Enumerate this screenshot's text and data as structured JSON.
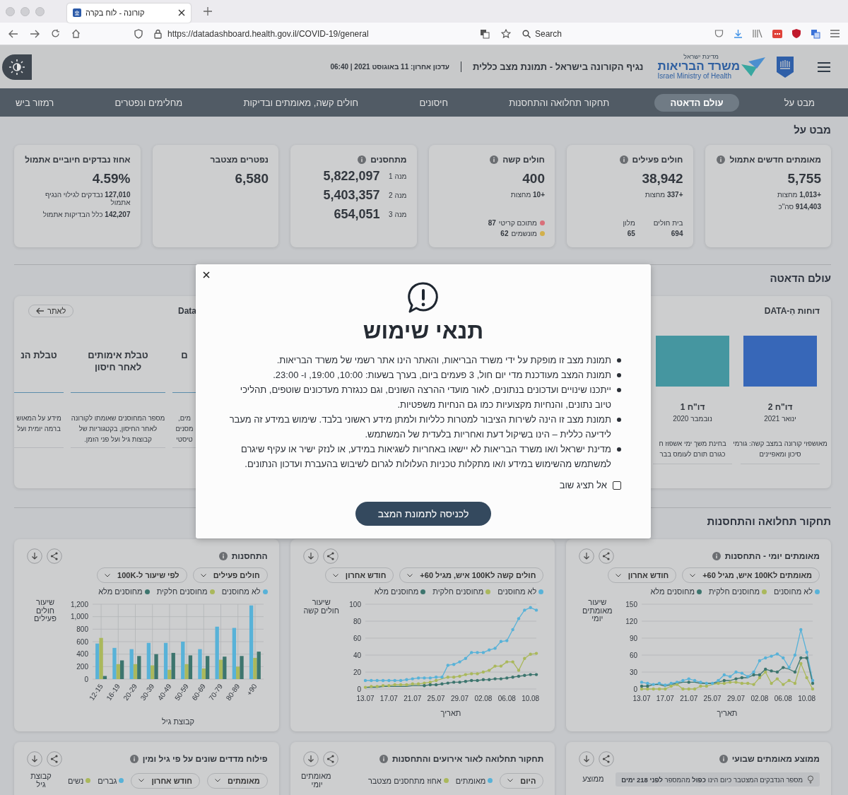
{
  "browser": {
    "tab_title": "קורונה - לוח בקרה",
    "url": "https://datadashboard.health.gov.il/COVID-19/general",
    "search": "Search"
  },
  "header": {
    "org_small": "מדינת ישראל",
    "org": "משרד הבריאות",
    "org_en": "Israel Ministry of Health",
    "title": "נגיף הקורונה בישראל - תמונת מצב כללית",
    "updated": "עדכון אחרון: 11 באוגוסט 2021 | 06:40"
  },
  "nav": [
    {
      "label": "מבט על",
      "selected": false
    },
    {
      "label": "עולם הדאטה",
      "selected": true
    },
    {
      "label": "תחקור תחלואה והתחסנות",
      "selected": false
    },
    {
      "label": "חיסונים",
      "selected": false
    },
    {
      "label": "חולים קשה, מאומתים ובדיקות",
      "selected": false
    },
    {
      "label": "מחלימים ונפטרים",
      "selected": false
    },
    {
      "label": "רמזור ביש",
      "selected": false
    }
  ],
  "overview": {
    "title": "מבט על",
    "cards": [
      {
        "title": "מאומתים חדשים אתמול",
        "info": true,
        "value": "5,755",
        "details": [
          "**+1,013** מחצות",
          "**914,403** סה\"כ"
        ]
      },
      {
        "title": "חולים פעילים",
        "info": true,
        "value": "38,942",
        "details": [
          "**+337** מחצות"
        ],
        "split": [
          {
            "label": "בית חולים",
            "value": "694"
          },
          {
            "label": "מלון",
            "value": "65"
          }
        ]
      },
      {
        "title": "חולים קשה",
        "info": true,
        "value": "400",
        "details": [
          "**+10** מחצות"
        ],
        "flagged": [
          {
            "label": "מתוכם קריטי",
            "value": "87",
            "color": "#d9707a"
          },
          {
            "label": "מונשמים",
            "value": "62",
            "color": "#d2b04c"
          }
        ]
      },
      {
        "title": "מתחסנים",
        "info": true,
        "doses": [
          {
            "label": "מנה 1",
            "value": "5,822,097"
          },
          {
            "label": "מנה 2",
            "value": "5,403,357"
          },
          {
            "label": "מנה 3",
            "value": "654,051"
          }
        ]
      },
      {
        "title": "נפטרים מצטבר",
        "info": false,
        "value": "6,580"
      },
      {
        "title": "אחוז נבדקים חיוביים אתמול",
        "info": false,
        "value": "4.59%",
        "details": [
          "**127,010** נבדקים לגילוי הנגיף אתמול",
          "**142,207** כלל הבדיקות אתמול"
        ]
      }
    ]
  },
  "data_world": {
    "title": "עולם הדאטה",
    "reports": {
      "title": "דוחות הַ-DATA",
      "items": [
        {
          "title": "דו\"ח 2",
          "date": "ינואר 2021",
          "lines": [
            "מאושפזי קורונה במצב קשה: גורמי",
            "סיכון ומאפיינים"
          ]
        },
        {
          "title": "דו\"ח 1",
          "date": "נובמבר 2020",
          "lines": [
            "בחינת משך ימי אשפוז ח",
            "כגורם תורם לעומס בבר"
          ]
        }
      ]
    },
    "tables": {
      "title": "Data",
      "link": "לאתר",
      "items": [
        {
          "title_lines": [
            "ם"
          ],
          "lines": [
            "מים,",
            "מסנים",
            "טיסטי"
          ]
        },
        {
          "title_lines": [
            "טבלת אימותים",
            "לאחר חיסון"
          ],
          "lines": [
            "מספר המחוסנים שאומתו לקורונה",
            "לאחר החיסון, בקטגוריות של",
            "קבוצות גיל ועל פני הזמן."
          ]
        },
        {
          "title_lines": [
            "טבלת הנ"
          ],
          "lines": [
            "מידע על המאוש",
            "ברמה יומית ועל"
          ]
        }
      ]
    }
  },
  "trends": {
    "title": "תחקור תחלואה והתחסנות",
    "charts": [
      {
        "title": "מאומתים יומי - התחסנות",
        "dropdowns": [
          "מאומתים ל100K איש, מגיל 60+",
          "חודש אחרון"
        ],
        "chart_data": {
          "type": "line",
          "ylabel": "שיעור מאומתים יומי",
          "xlabel": "תאריך",
          "grid": true,
          "ylim": [
            0,
            150
          ],
          "yticks": [
            0,
            30,
            60,
            90,
            120,
            150
          ],
          "categories": [
            "13.07",
            null,
            null,
            null,
            "17.07",
            null,
            null,
            null,
            "21.07",
            null,
            null,
            null,
            "25.07",
            null,
            null,
            null,
            "29.07",
            null,
            null,
            null,
            "02.08",
            null,
            null,
            null,
            "06.08",
            null,
            null,
            null,
            "10.08",
            null
          ],
          "series": [
            {
              "name": "לא מחוסנים",
              "color": "#58b2d8",
              "values": [
                12,
                10,
                8,
                10,
                7,
                10,
                12,
                15,
                18,
                15,
                12,
                10,
                10,
                15,
                25,
                22,
                30,
                28,
                22,
                30,
                50,
                55,
                58,
                62,
                55,
                38,
                60,
                105,
                65,
                15
              ]
            },
            {
              "name": "מחוסנים חלקית",
              "color": "#aab85c",
              "values": [
                0,
                0,
                0,
                0,
                0,
                5,
                8,
                0,
                0,
                0,
                5,
                5,
                8,
                10,
                10,
                12,
                12,
                10,
                10,
                8,
                20,
                30,
                10,
                18,
                8,
                15,
                10,
                45,
                20,
                0
              ]
            },
            {
              "name": "מחוסנים מלא",
              "color": "#3d756e",
              "values": [
                5,
                5,
                8,
                8,
                5,
                8,
                10,
                12,
                12,
                12,
                10,
                10,
                10,
                12,
                15,
                15,
                18,
                20,
                20,
                25,
                25,
                35,
                32,
                30,
                38,
                35,
                30,
                55,
                55,
                10
              ]
            }
          ]
        }
      },
      {
        "dropdowns": [
          "חולים קשה ל100K איש, מגיל 60+",
          "חודש אחרון"
        ],
        "chart_data": {
          "type": "line",
          "ylabel": "שיעור חולים קשה",
          "xlabel": "תאריך",
          "grid": true,
          "ylim": [
            0,
            100
          ],
          "yticks": [
            0,
            20,
            40,
            60,
            80,
            100
          ],
          "categories": [
            "13.07",
            null,
            null,
            null,
            "17.07",
            null,
            null,
            null,
            "21.07",
            null,
            null,
            null,
            "25.07",
            null,
            null,
            null,
            "29.07",
            null,
            null,
            null,
            "02.08",
            null,
            null,
            null,
            "06.08",
            null,
            null,
            null,
            "10.08",
            null
          ],
          "series": [
            {
              "name": "לא מחוסנים",
              "color": "#58b2d8",
              "values": [
                10,
                10,
                10,
                10,
                10,
                10,
                10,
                11,
                12,
                13,
                13,
                13,
                14,
                14,
                28,
                29,
                32,
                36,
                43,
                43,
                43,
                46,
                48,
                56,
                57,
                70,
                83,
                93,
                96,
                93
              ]
            },
            {
              "name": "מחוסנים חלקית",
              "color": "#aab85c",
              "values": [
                2,
                3,
                3,
                4,
                4,
                5,
                5,
                5,
                6,
                6,
                7,
                8,
                10,
                12,
                14,
                14,
                15,
                17,
                18,
                18,
                20,
                22,
                27,
                27,
                32,
                32,
                22,
                36,
                41,
                42
              ]
            },
            {
              "name": "מחוסנים מלא",
              "color": "#3d756e",
              "values": [
                2,
                2,
                2,
                3,
                3,
                3,
                3,
                3,
                4,
                4,
                4,
                5,
                5,
                6,
                7,
                8,
                8,
                9,
                10,
                10,
                11,
                11,
                12,
                12,
                13,
                14,
                15,
                16,
                17,
                17
              ]
            }
          ]
        }
      },
      {
        "title": "התחסנות",
        "dropdowns": [
          "חולים פעילים",
          "לפי שיעור ל-100K"
        ],
        "chart_data": {
          "type": "bar",
          "ylabel": "שיעור חולים פעילים",
          "xlabel": "קבוצת גיל",
          "grid": true,
          "categories": [
            "12-15",
            "16-19",
            "20-29",
            "30-39",
            "40-49",
            "50-59",
            "60-69",
            "70-79",
            "80-89",
            "+90"
          ],
          "ylim": [
            0,
            1200
          ],
          "yticks": [
            0,
            200,
            400,
            600,
            800,
            {
              "value": 1000,
              "label": "1,000"
            },
            {
              "value": 1200,
              "label": "1,200"
            }
          ],
          "series": [
            {
              "name": "לא מחוסנים",
              "color": "#58b2d8",
              "values": [
                570,
                500,
                480,
                580,
                580,
                600,
                480,
                840,
                820,
                1180
              ]
            },
            {
              "name": "מחוסנים חלקית",
              "color": "#aab85c",
              "values": [
                660,
                240,
                240,
                220,
                150,
                240,
                170,
                310,
                200,
                340
              ]
            },
            {
              "name": "מחוסנים מלא",
              "color": "#3d756e",
              "values": [
                50,
                300,
                370,
                400,
                420,
                380,
                370,
                360,
                370,
                440
              ]
            }
          ]
        }
      }
    ]
  },
  "more_cards": [
    {
      "title": "ממוצע מאומתים שבועי",
      "banner": "מספר הנדבקים המצטבר כיום הינו **כפול** מהמספר **לפני 218 ימים**",
      "ylabel": "ממוצע"
    },
    {
      "title": "תחקור תחלואה לאור אירועים והתחסנות",
      "dropdowns": [
        "היום"
      ],
      "legend": [
        {
          "label": "מאומתים",
          "color": "#58b2d8"
        },
        {
          "label": "אחוז מתחסנים מצטבר",
          "color": "#aab85c"
        }
      ],
      "ylabel": "מאומתים יומי"
    },
    {
      "title": "פילוח מדדים שונים על פי גיל ומין",
      "dropdowns": [
        "מאומתים",
        "חודש אחרון"
      ],
      "legend": [
        {
          "label": "גברים",
          "color": "#58b2d8"
        },
        {
          "label": "נשים",
          "color": "#aab85c"
        }
      ],
      "ylabel": "קבוצת גיל"
    }
  ],
  "modal": {
    "title": "תנאי שימוש",
    "items": [
      "תמונת מצב זו מופקת על ידי משרד הבריאות, והאתר הינו אתר רשמי של משרד הבריאות.",
      "תמונת המצב מעודכנת מדי יום חול, 3 פעמים ביום, בערך בשעות: 10:00, 19:00, ו- 23:00.",
      "ייתכנו שינויים ועדכונים בנתונים, לאור מועדי ההרצה השונים, וגם כנגזרת מעדכונים שוטפים, תהליכי טיוב נתונים, והנחיות מקצועיות כמו גם הנחיות משפטיות.",
      "תמונת מצב זו הינה לשירות הציבור למטרות כלליות ולמתן מידע ראשוני בלבד. שימוש במידע זה מעבר לידיעה כללית – הינו בשיקול דעת ואחריות בלעדית של המשתמש.",
      "מדינת ישראל ו/או משרד הבריאות לא יישאו באחריות לשגיאות במידע, או לנזק ישיר או עקיף שיגרם למשתמש מהשימוש במידע ו/או מתקלות טכניות העלולות לגרום לשיבוש בהעברת ועדכון הנתונים."
    ],
    "dont_show": {
      "label": "אל תציג שוב",
      "checked": false
    },
    "button": "לכניסה לתמונת המצב"
  }
}
